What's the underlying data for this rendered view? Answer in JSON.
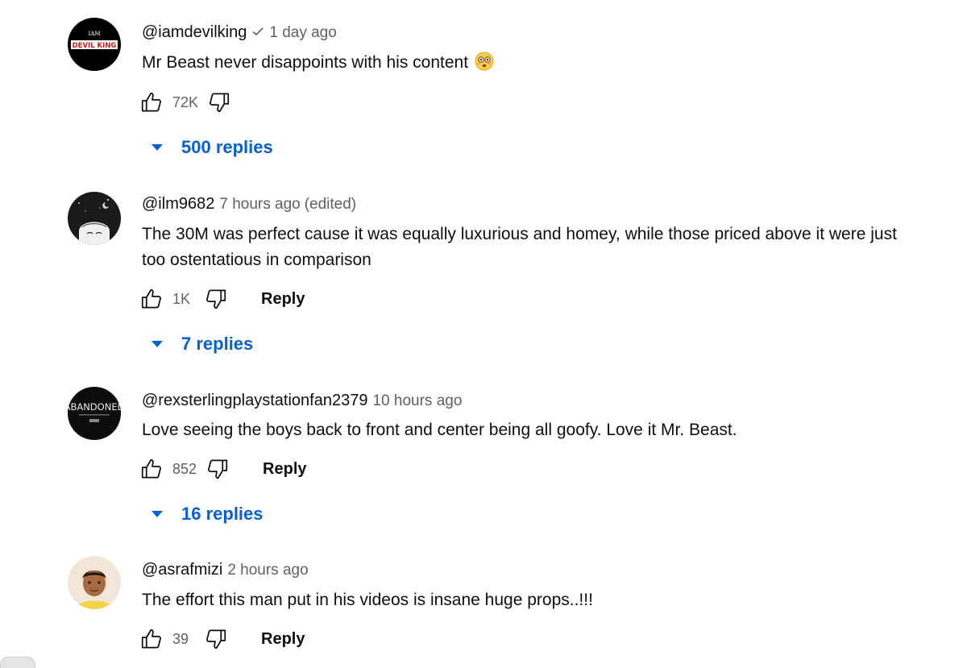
{
  "comments": [
    {
      "author": "@iamdevilking",
      "time": "1 day ago",
      "verified": true,
      "edited": "",
      "text": "Mr Beast never disappoints with his content",
      "emoji": "flushed-face-icon",
      "likes": "72K",
      "reply_label": "",
      "replies": "500 replies",
      "avatar": {
        "name": "avatar-devil-king",
        "line1": "IAM",
        "line2": "DEVIL KING",
        "bg": "#000000",
        "accent": "#d11a1a"
      }
    },
    {
      "author": "@ilm9682",
      "time": "7 hours ago",
      "verified": false,
      "edited": "(edited)",
      "text": "The 30M was perfect cause it was equally luxurious and homey, while those priced above it were just too ostentatious in comparison",
      "likes": "1K",
      "reply_label": "Reply",
      "replies": "7 replies",
      "avatar": {
        "name": "avatar-ilm",
        "bg": "#1a1a1a"
      }
    },
    {
      "author": "@rexsterlingplaystationfan2379",
      "time": "10 hours ago",
      "verified": false,
      "edited": "",
      "text": "Love seeing the boys back to front and center being all goofy. Love it Mr. Beast.",
      "likes": "852",
      "reply_label": "Reply",
      "replies": "16 replies",
      "avatar": {
        "name": "avatar-abandoned",
        "line1": "ABANDONED",
        "bg": "#0d0d0d"
      }
    },
    {
      "author": "@asrafmizi",
      "time": "2 hours ago",
      "verified": false,
      "edited": "",
      "text": "The effort this man put in his videos is insane huge props..!!!",
      "likes": "39",
      "reply_label": "Reply",
      "replies": "",
      "avatar": {
        "name": "avatar-asrafmizi",
        "bg": "#f2e6d8"
      }
    }
  ],
  "colors": {
    "link_blue": "#065fd4",
    "secondary_text": "#606060",
    "primary_text": "#0f0f0f"
  }
}
